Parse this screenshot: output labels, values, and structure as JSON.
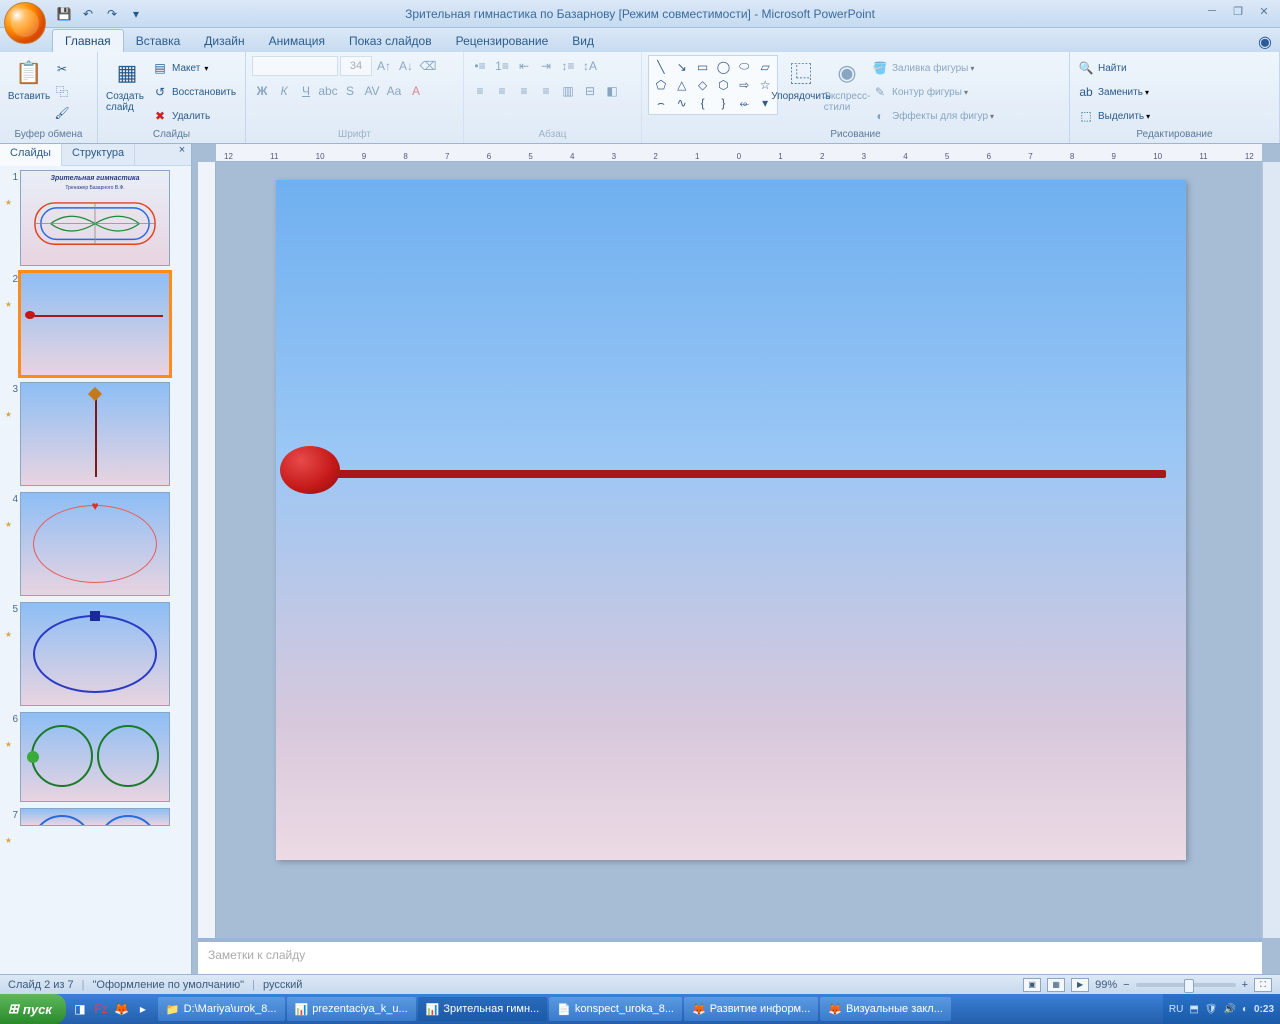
{
  "title": "Зрительная гимнастика по Базарнову [Режим совместимости] - Microsoft PowerPoint",
  "tabs": {
    "home": "Главная",
    "insert": "Вставка",
    "design": "Дизайн",
    "anim": "Анимация",
    "show": "Показ слайдов",
    "review": "Рецензирование",
    "view": "Вид"
  },
  "groups": {
    "clipboard": "Буфер обмена",
    "slides": "Слайды",
    "font": "Шрифт",
    "para": "Абзац",
    "draw": "Рисование",
    "edit": "Редактирование",
    "paste": "Вставить",
    "newslide": "Создать слайд",
    "layout": "Макет",
    "reset": "Восстановить",
    "delete": "Удалить",
    "arrange": "Упорядочить",
    "styles": "Экспресс-стили",
    "fill": "Заливка фигуры",
    "outline": "Контур фигуры",
    "effects": "Эффекты для фигур",
    "find": "Найти",
    "replace": "Заменить",
    "select": "Выделить"
  },
  "fontSize": "34",
  "panel": {
    "slides": "Слайды",
    "outline": "Структура"
  },
  "thumb1": {
    "title": "Зрительная гимнастика",
    "sub": "Тренажер Базарного В.Ф."
  },
  "notes": "Заметки к слайду",
  "status": {
    "slide": "Слайд 2 из 7",
    "theme": "\"Оформление по умолчанию\"",
    "lang": "русский",
    "zoom": "99%"
  },
  "taskbar": {
    "start": "пуск",
    "t1": "D:\\Mariya\\urok_8...",
    "t2": "prezentaciya_k_u...",
    "t3": "Зрительная гимн...",
    "t4": "konspect_uroka_8...",
    "t5": "Развитие информ...",
    "t6": "Визуальные закл...",
    "lang": "RU",
    "time": "0:23"
  }
}
